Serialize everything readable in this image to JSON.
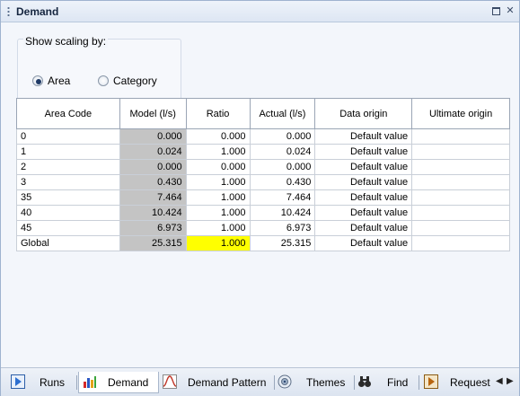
{
  "window": {
    "title": "Demand"
  },
  "scaling": {
    "label": "Show scaling by:",
    "options": [
      {
        "label": "Area",
        "selected": true
      },
      {
        "label": "Category",
        "selected": false
      }
    ]
  },
  "table": {
    "headers": [
      "Area Code",
      "Model (l/s)",
      "Ratio",
      "Actual (l/s)",
      "Data origin",
      "Ultimate origin"
    ],
    "rows": [
      {
        "code": "0",
        "model": "0.000",
        "ratio": "0.000",
        "actual": "0.000",
        "origin": "Default value",
        "ultimate": ""
      },
      {
        "code": "1",
        "model": "0.024",
        "ratio": "1.000",
        "actual": "0.024",
        "origin": "Default value",
        "ultimate": ""
      },
      {
        "code": "2",
        "model": "0.000",
        "ratio": "0.000",
        "actual": "0.000",
        "origin": "Default value",
        "ultimate": ""
      },
      {
        "code": "3",
        "model": "0.430",
        "ratio": "1.000",
        "actual": "0.430",
        "origin": "Default value",
        "ultimate": ""
      },
      {
        "code": "35",
        "model": "7.464",
        "ratio": "1.000",
        "actual": "7.464",
        "origin": "Default value",
        "ultimate": ""
      },
      {
        "code": "40",
        "model": "10.424",
        "ratio": "1.000",
        "actual": "10.424",
        "origin": "Default value",
        "ultimate": ""
      },
      {
        "code": "45",
        "model": "6.973",
        "ratio": "1.000",
        "actual": "6.973",
        "origin": "Default value",
        "ultimate": ""
      },
      {
        "code": "Global",
        "model": "25.315",
        "ratio": "1.000",
        "actual": "25.315",
        "origin": "Default value",
        "ultimate": ""
      }
    ]
  },
  "tabs": [
    {
      "label": "Runs",
      "icon": "play-icon",
      "active": false
    },
    {
      "label": "Demand",
      "icon": "bar-chart-icon",
      "active": true
    },
    {
      "label": "Demand Pattern",
      "icon": "pattern-curve-icon",
      "active": false
    },
    {
      "label": "Themes",
      "icon": "themes-icon",
      "active": false
    },
    {
      "label": "Find",
      "icon": "binoculars-icon",
      "active": false
    },
    {
      "label": "Request",
      "icon": "request-icon",
      "active": false
    }
  ],
  "colors": {
    "model_cell": "#c4c4c4",
    "highlight_cell": "#ffff00",
    "accent": "#1f3a66"
  }
}
